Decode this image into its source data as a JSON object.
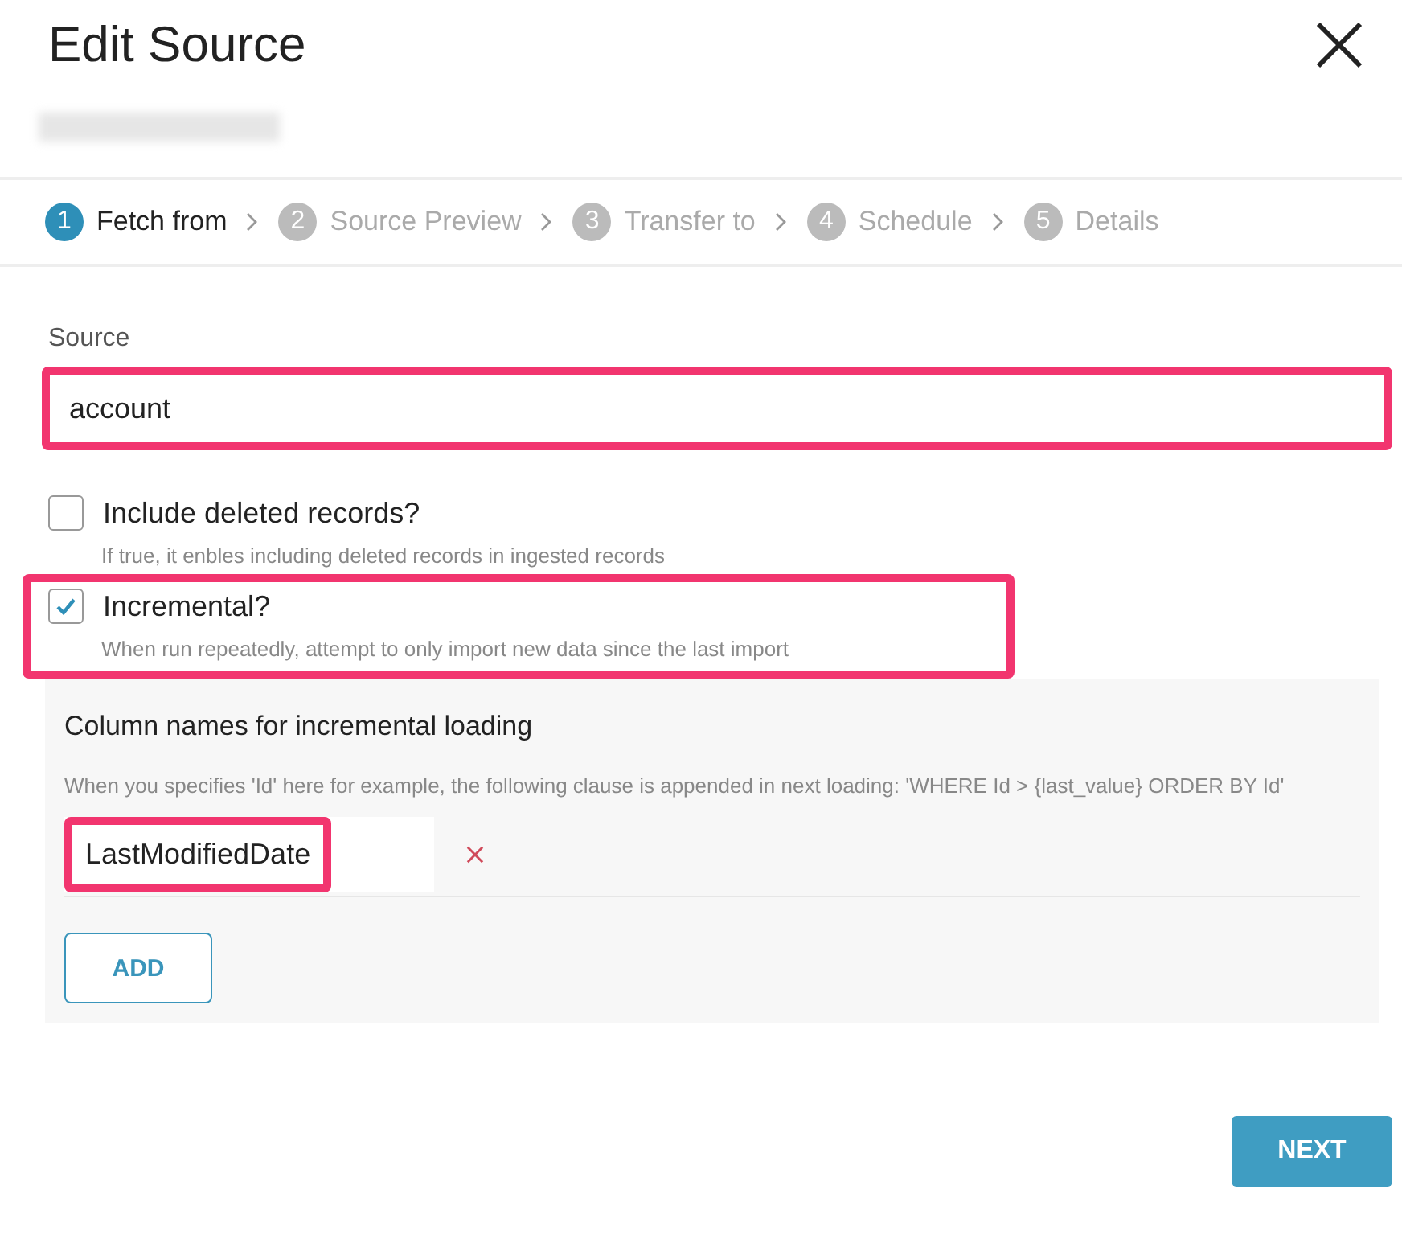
{
  "dialog": {
    "title": "Edit Source",
    "subtitle_redacted": true
  },
  "steps": [
    {
      "number": "1",
      "label": "Fetch from",
      "selected": true
    },
    {
      "number": "2",
      "label": "Source Preview",
      "selected": false
    },
    {
      "number": "3",
      "label": "Transfer to",
      "selected": false
    },
    {
      "number": "4",
      "label": "Schedule",
      "selected": false
    },
    {
      "number": "5",
      "label": "Details",
      "selected": false
    }
  ],
  "source": {
    "label": "Source",
    "value": "account",
    "highlighted": true
  },
  "options": [
    {
      "label": "Include deleted records?",
      "hint": "If true, it enbles including deleted records in ingested records",
      "checked": false,
      "highlighted": false
    },
    {
      "label": "Incremental?",
      "hint": "When run repeatedly, attempt to only import new data since the last import",
      "checked": true,
      "highlighted": true
    }
  ],
  "incremental_panel": {
    "title": "Column names for incremental loading",
    "hint": "When you specifies 'Id' here for example, the following clause is appended in next loading: 'WHERE Id > {last_value} ORDER BY Id'",
    "columns": [
      {
        "value": "LastModifiedDate",
        "highlighted": true
      }
    ],
    "add_button": "ADD"
  },
  "next_button": "NEXT"
}
